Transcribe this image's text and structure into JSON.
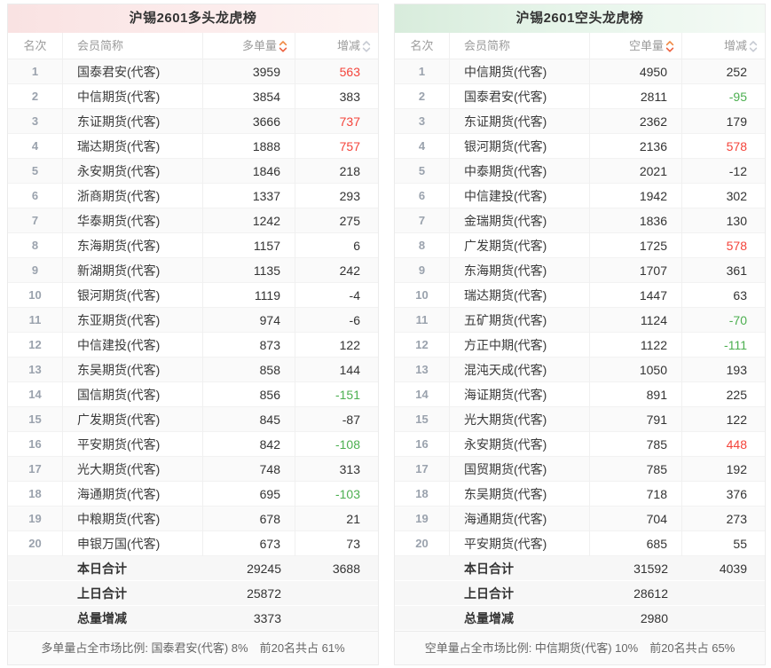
{
  "colors": {
    "up_red": "#f4443b",
    "down_green": "#4caf50",
    "neutral": "#333333",
    "long_header_bg": "#fcecec",
    "short_header_bg": "#e9f6ec",
    "sort_active": "#f0813f",
    "sort_inactive": "#c6cad2"
  },
  "boards": [
    {
      "title": "沪锡2601多头龙虎榜",
      "columns": {
        "rank": "名次",
        "member": "会员简称",
        "volume": "多单量",
        "change": "增减"
      },
      "rows": [
        {
          "rank": "1",
          "member": "国泰君安(代客)",
          "volume": "3959",
          "change": "563",
          "change_color": "red"
        },
        {
          "rank": "2",
          "member": "中信期货(代客)",
          "volume": "3854",
          "change": "383",
          "change_color": "dark"
        },
        {
          "rank": "3",
          "member": "东证期货(代客)",
          "volume": "3666",
          "change": "737",
          "change_color": "red"
        },
        {
          "rank": "4",
          "member": "瑞达期货(代客)",
          "volume": "1888",
          "change": "757",
          "change_color": "red"
        },
        {
          "rank": "5",
          "member": "永安期货(代客)",
          "volume": "1846",
          "change": "218",
          "change_color": "dark"
        },
        {
          "rank": "6",
          "member": "浙商期货(代客)",
          "volume": "1337",
          "change": "293",
          "change_color": "dark"
        },
        {
          "rank": "7",
          "member": "华泰期货(代客)",
          "volume": "1242",
          "change": "275",
          "change_color": "dark"
        },
        {
          "rank": "8",
          "member": "东海期货(代客)",
          "volume": "1157",
          "change": "6",
          "change_color": "dark"
        },
        {
          "rank": "9",
          "member": "新湖期货(代客)",
          "volume": "1135",
          "change": "242",
          "change_color": "dark"
        },
        {
          "rank": "10",
          "member": "银河期货(代客)",
          "volume": "1119",
          "change": "-4",
          "change_color": "dark"
        },
        {
          "rank": "11",
          "member": "东亚期货(代客)",
          "volume": "974",
          "change": "-6",
          "change_color": "dark"
        },
        {
          "rank": "12",
          "member": "中信建投(代客)",
          "volume": "873",
          "change": "122",
          "change_color": "dark"
        },
        {
          "rank": "13",
          "member": "东吴期货(代客)",
          "volume": "858",
          "change": "144",
          "change_color": "dark"
        },
        {
          "rank": "14",
          "member": "国信期货(代客)",
          "volume": "856",
          "change": "-151",
          "change_color": "green"
        },
        {
          "rank": "15",
          "member": "广发期货(代客)",
          "volume": "845",
          "change": "-87",
          "change_color": "dark"
        },
        {
          "rank": "16",
          "member": "平安期货(代客)",
          "volume": "842",
          "change": "-108",
          "change_color": "green"
        },
        {
          "rank": "17",
          "member": "光大期货(代客)",
          "volume": "748",
          "change": "313",
          "change_color": "dark"
        },
        {
          "rank": "18",
          "member": "海通期货(代客)",
          "volume": "695",
          "change": "-103",
          "change_color": "green"
        },
        {
          "rank": "19",
          "member": "中粮期货(代客)",
          "volume": "678",
          "change": "21",
          "change_color": "dark"
        },
        {
          "rank": "20",
          "member": "申银万国(代客)",
          "volume": "673",
          "change": "73",
          "change_color": "dark"
        }
      ],
      "summary": [
        {
          "label": "本日合计",
          "volume": "29245",
          "change": "3688"
        },
        {
          "label": "上日合计",
          "volume": "25872",
          "change": ""
        },
        {
          "label": "总量增减",
          "volume": "3373",
          "change": ""
        }
      ],
      "note": "多单量占全市场比例: 国泰君安(代客) 8%　前20名共占 61%"
    },
    {
      "title": "沪锡2601空头龙虎榜",
      "columns": {
        "rank": "名次",
        "member": "会员简称",
        "volume": "空单量",
        "change": "增减"
      },
      "rows": [
        {
          "rank": "1",
          "member": "中信期货(代客)",
          "volume": "4950",
          "change": "252",
          "change_color": "dark"
        },
        {
          "rank": "2",
          "member": "国泰君安(代客)",
          "volume": "2811",
          "change": "-95",
          "change_color": "green"
        },
        {
          "rank": "3",
          "member": "东证期货(代客)",
          "volume": "2362",
          "change": "179",
          "change_color": "dark"
        },
        {
          "rank": "4",
          "member": "银河期货(代客)",
          "volume": "2136",
          "change": "578",
          "change_color": "red"
        },
        {
          "rank": "5",
          "member": "中泰期货(代客)",
          "volume": "2021",
          "change": "-12",
          "change_color": "dark"
        },
        {
          "rank": "6",
          "member": "中信建投(代客)",
          "volume": "1942",
          "change": "302",
          "change_color": "dark"
        },
        {
          "rank": "7",
          "member": "金瑞期货(代客)",
          "volume": "1836",
          "change": "130",
          "change_color": "dark"
        },
        {
          "rank": "8",
          "member": "广发期货(代客)",
          "volume": "1725",
          "change": "578",
          "change_color": "red"
        },
        {
          "rank": "9",
          "member": "东海期货(代客)",
          "volume": "1707",
          "change": "361",
          "change_color": "dark"
        },
        {
          "rank": "10",
          "member": "瑞达期货(代客)",
          "volume": "1447",
          "change": "63",
          "change_color": "dark"
        },
        {
          "rank": "11",
          "member": "五矿期货(代客)",
          "volume": "1124",
          "change": "-70",
          "change_color": "green"
        },
        {
          "rank": "12",
          "member": "方正中期(代客)",
          "volume": "1122",
          "change": "-111",
          "change_color": "green"
        },
        {
          "rank": "13",
          "member": "混沌天成(代客)",
          "volume": "1050",
          "change": "193",
          "change_color": "dark"
        },
        {
          "rank": "14",
          "member": "海证期货(代客)",
          "volume": "891",
          "change": "225",
          "change_color": "dark"
        },
        {
          "rank": "15",
          "member": "光大期货(代客)",
          "volume": "791",
          "change": "122",
          "change_color": "dark"
        },
        {
          "rank": "16",
          "member": "永安期货(代客)",
          "volume": "785",
          "change": "448",
          "change_color": "red"
        },
        {
          "rank": "17",
          "member": "国贸期货(代客)",
          "volume": "785",
          "change": "192",
          "change_color": "dark"
        },
        {
          "rank": "18",
          "member": "东吴期货(代客)",
          "volume": "718",
          "change": "376",
          "change_color": "dark"
        },
        {
          "rank": "19",
          "member": "海通期货(代客)",
          "volume": "704",
          "change": "273",
          "change_color": "dark"
        },
        {
          "rank": "20",
          "member": "平安期货(代客)",
          "volume": "685",
          "change": "55",
          "change_color": "dark"
        }
      ],
      "summary": [
        {
          "label": "本日合计",
          "volume": "31592",
          "change": "4039"
        },
        {
          "label": "上日合计",
          "volume": "28612",
          "change": ""
        },
        {
          "label": "总量增减",
          "volume": "2980",
          "change": ""
        }
      ],
      "note": "空单量占全市场比例: 中信期货(代客) 10%　前20名共占 65%"
    }
  ]
}
